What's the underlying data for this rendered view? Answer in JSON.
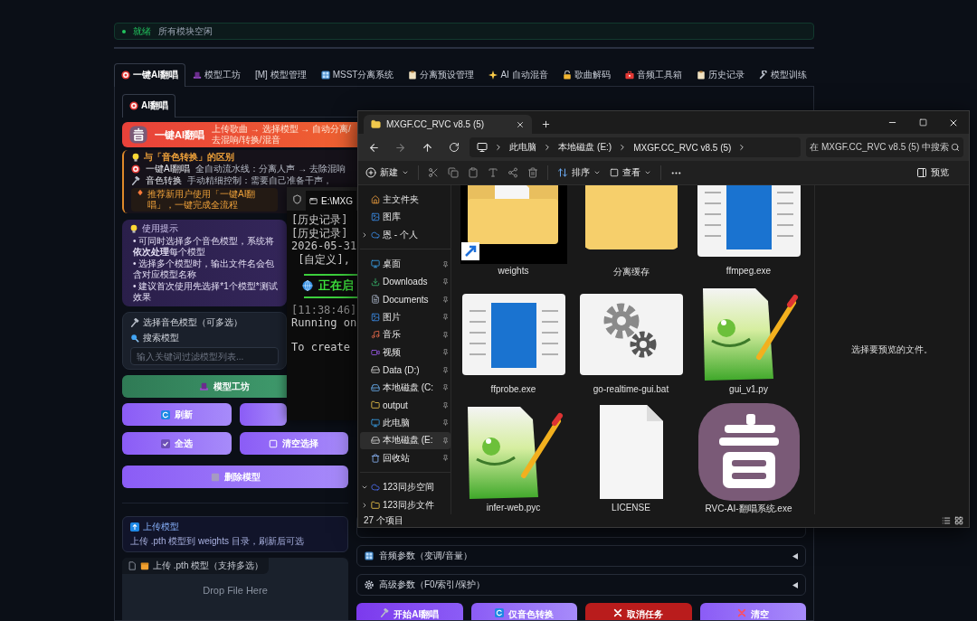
{
  "status": {
    "state": "就绪",
    "message": "所有模块空闲"
  },
  "tabs": [
    {
      "kind": "target",
      "label": "一键AI翻唱",
      "selected": true
    },
    {
      "kind": "hat",
      "label": "模型工坊",
      "selected": false
    },
    {
      "kind": "plain",
      "label": "[M] 模型管理",
      "selected": false
    },
    {
      "kind": "grid",
      "label": "MSST分离系统",
      "selected": false
    },
    {
      "kind": "clipboard",
      "label": "分离预设管理",
      "selected": false
    },
    {
      "kind": "sparkle",
      "label": "AI 自动混音",
      "selected": false
    },
    {
      "kind": "lock",
      "label": "歌曲解码",
      "selected": false
    },
    {
      "kind": "toolbox",
      "label": "音频工具箱",
      "selected": false
    },
    {
      "kind": "clipboard",
      "label": "历史记录",
      "selected": false
    },
    {
      "kind": "wrench",
      "label": "模型训练",
      "selected": false
    }
  ],
  "subtabs": [
    {
      "kind": "target",
      "label": "AI翻唱",
      "selected": true
    }
  ],
  "header": {
    "title": "一键AI翻唱",
    "subtitle": "上传歌曲 → 选择模型 → 自动分离/去混响/转换/混音"
  },
  "difference": {
    "title": "与「音色转换」的区别",
    "rows": [
      {
        "kind": "target",
        "name": "一键AI翻唱",
        "text": "全自动流水线：分离人声 → 去除混响"
      },
      {
        "kind": "hammer",
        "name": "音色转换",
        "text": "手动精细控制：需要自己准备干声，"
      }
    ],
    "note": "推荐新用户使用「一键AI翻唱」，一键完成全流程"
  },
  "tips": {
    "title": "使用提示",
    "items": [
      "• 可同时选择多个音色模型，系统将**依次处理**每个模型",
      "• 选择多个模型时，输出文件名会包含对应模型名称",
      "• 建议首次使用先选择*1个模型*测试效果"
    ]
  },
  "model_select": {
    "title": "选择音色模型（可多选）",
    "search_label": "搜索模型",
    "search_placeholder": "输入关键词过滤模型列表..."
  },
  "workshop_button": "模型工坊",
  "model_buttons": [
    {
      "kind": "refresh",
      "label": "刷新"
    },
    {
      "kind": "blank"
    },
    {
      "kind": "check",
      "label": "全选"
    },
    {
      "kind": "square",
      "label": "清空选择"
    }
  ],
  "delete_button": "删除模型",
  "upload": {
    "title": "上传模型",
    "text": "上传 .pth 模型到 weights 目录，刷新后可选"
  },
  "dropzone": {
    "label": "上传 .pth 模型（支持多选）",
    "prompt": "Drop File Here"
  },
  "accordions": [
    {
      "kind": "grid",
      "title": "音频参数（变调/音量）"
    },
    {
      "kind": "gear",
      "title": "高级参数（F0/索引/保护）"
    }
  ],
  "actions": [
    {
      "kind": "primary",
      "label": "开始AI翻唱"
    },
    {
      "kind": "secondary",
      "label": "仅音色转换"
    },
    {
      "kind": "danger",
      "label": "取消任务"
    },
    {
      "kind": "clear",
      "label": "清空"
    }
  ],
  "terminal": {
    "tab": "E:\\MXG",
    "lines": [
      "[历史记录]",
      "[历史记录]",
      "2026-05-31",
      " [自定义],"
    ],
    "banner": "正在启",
    "log": [
      "[11:38:46]",
      "Running on"
    ],
    "footer": "To create"
  },
  "explorer": {
    "tab": "MXGF.CC_RVC v8.5 (5)",
    "path": [
      "此电脑",
      "本地磁盘 (E:)",
      "MXGF.CC_RVC v8.5 (5)"
    ],
    "search_placeholder": "在 MXGF.CC_RVC v8.5 (5) 中搜索",
    "commands": {
      "new": "新建",
      "sort": "排序",
      "view": "查看",
      "preview": "预览"
    },
    "sidebar": [
      [
        {
          "kind": "home",
          "label": "主文件夹",
          "pinned": false,
          "selected": false
        },
        {
          "kind": "gallery",
          "label": "图库",
          "pinned": false,
          "selected": false
        },
        {
          "kind": "cloud",
          "label": "恩 - 个人",
          "pinned": false,
          "selected": false,
          "expanded": false
        }
      ],
      [
        {
          "kind": "desktop",
          "label": "桌面",
          "pinned": true,
          "selected": false
        },
        {
          "kind": "download",
          "label": "Downloads",
          "pinned": true,
          "selected": false
        },
        {
          "kind": "document",
          "label": "Documents",
          "pinned": true,
          "selected": false
        },
        {
          "kind": "gallery",
          "label": "图片",
          "pinned": true,
          "selected": false
        },
        {
          "kind": "music",
          "label": "音乐",
          "pinned": true,
          "selected": false
        },
        {
          "kind": "video",
          "label": "视频",
          "pinned": true,
          "selected": false
        },
        {
          "kind": "drive",
          "label": "Data (D:)",
          "pinned": true,
          "selected": false
        },
        {
          "kind": "system-drive",
          "label": "本地磁盘 (C:",
          "pinned": true,
          "selected": false
        },
        {
          "kind": "folder",
          "label": "output",
          "pinned": true,
          "selected": false
        },
        {
          "kind": "pc",
          "label": "此电脑",
          "pinned": true,
          "selected": false
        },
        {
          "kind": "drive",
          "label": "本地磁盘 (E:",
          "pinned": true,
          "selected": true
        },
        {
          "kind": "bin",
          "label": "回收站",
          "pinned": true,
          "selected": false
        }
      ],
      [
        {
          "kind": "sync",
          "label": "123同步空间",
          "pinned": false,
          "selected": false,
          "expanded": true
        },
        {
          "kind": "folder",
          "label": "123同步文件",
          "pinned": false,
          "selected": false,
          "expanded": false
        }
      ]
    ],
    "files": [
      {
        "kind": "folder-shortcut",
        "name": "weights"
      },
      {
        "kind": "folder",
        "name": "分离缓存"
      },
      {
        "kind": "exe",
        "name": "ffmpeg.exe"
      },
      {
        "kind": "exe",
        "name": "ffprobe.exe"
      },
      {
        "kind": "bat",
        "name": "go-realtime-gui.bat"
      },
      {
        "kind": "notepad",
        "name": "gui_v1.py"
      },
      {
        "kind": "notepad",
        "name": "infer-web.pyc"
      },
      {
        "kind": "blank",
        "name": "LICENSE"
      },
      {
        "kind": "app",
        "name": "RVC-AI-翻唱系统.exe"
      }
    ],
    "preview_text": "选择要预览的文件。",
    "status": "27 个项目"
  }
}
